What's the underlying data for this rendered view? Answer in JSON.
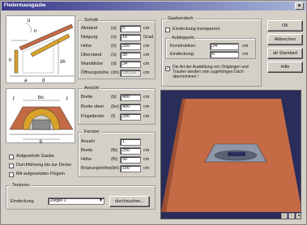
{
  "window": {
    "title": "Fledermausgaube",
    "close": "×"
  },
  "schnitt": {
    "title": "Schnitt",
    "rows": [
      {
        "label": "Abstand",
        "code": "(a)",
        "value": "0",
        "unit": "cm"
      },
      {
        "label": "Neigung",
        "code": "(n)",
        "value": "15",
        "unit": "Grad"
      },
      {
        "label": "Höhe",
        "code": "(h)",
        "value": "250",
        "unit": "cm"
      },
      {
        "label": "Überstand",
        "code": "(ü)",
        "value": "30",
        "unit": "cm"
      },
      {
        "label": "Wanddicke",
        "code": "(d)",
        "value": "24",
        "unit": "cm"
      },
      {
        "label": "Öffnungshöhe",
        "code": "(öh)",
        "value": "100,00",
        "unit": "cm"
      }
    ]
  },
  "ansicht": {
    "title": "Ansicht",
    "rows": [
      {
        "label": "Breite",
        "code": "(b)",
        "value": "400",
        "unit": "cm"
      },
      {
        "label": "Breite oben",
        "code": "(bo)",
        "value": "400",
        "unit": "cm"
      },
      {
        "label": "Flügelbreite",
        "code": "(f)",
        "value": "200",
        "unit": "cm"
      }
    ]
  },
  "fenster": {
    "title": "Fenster",
    "rows": [
      {
        "label": "Anzahl",
        "code": "",
        "value": "1",
        "unit": ""
      },
      {
        "label": "Breite",
        "code": "(fb)",
        "value": "250",
        "unit": "cm"
      },
      {
        "label": "Höhe",
        "code": "(fh)",
        "value": "50",
        "unit": "cm"
      },
      {
        "label": "Brüstungshöhe",
        "code": "(bh)",
        "value": "100",
        "unit": "cm"
      }
    ]
  },
  "options": [
    {
      "label": "Aufgesetzte Gaube",
      "checked": false
    },
    {
      "label": "Durchführung bis zur Decke",
      "checked": false
    },
    {
      "label": "Mit aufgesetzten Flügeln",
      "checked": false
    }
  ],
  "texturen": {
    "title": "Texturen",
    "label": "Eindeckung",
    "value": "Ziegel 1",
    "button": "durchsuchen..."
  },
  "gaubendach": {
    "title": "Gaubendach",
    "transparent_label": "Eindeckung transparent",
    "transparent_checked": false,
    "aufdoppeln_title": "Aufdoppeln",
    "rows": [
      {
        "label": "Konstruktion:",
        "value": "24",
        "unit": "cm"
      },
      {
        "label": "Eindeckung:",
        "value": "6",
        "unit": "cm"
      }
    ],
    "note": "Die Art der Ausbildung von Ortgängen und Traufen werden vom zugehörigen Dach übernommen !",
    "note_checked": true
  },
  "buttons": {
    "ok": "OK",
    "cancel": "Abbrechen",
    "default": "ab Standard",
    "help": "Hilfe"
  },
  "diagram_labels": {
    "ue": "ü",
    "n": "n",
    "h": "h",
    "oeh": "öh",
    "a": "a",
    "d": "d",
    "f": "f",
    "bo": "bo",
    "b": "b"
  },
  "colors": {
    "roof": "#c46a45",
    "wall": "#d9a32b",
    "sky": "#2a2d5a"
  }
}
